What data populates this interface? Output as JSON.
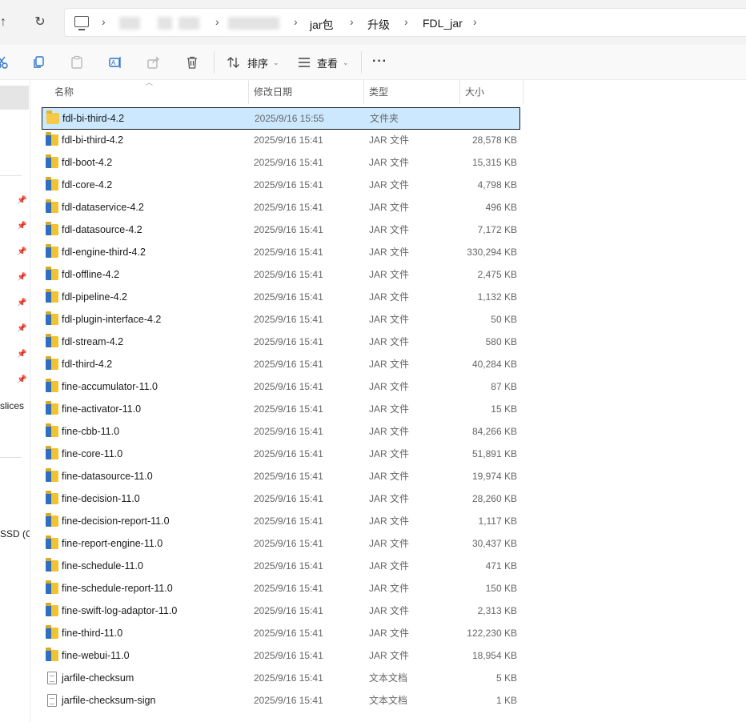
{
  "address": {
    "crumbs": [
      "jar包",
      "升级",
      "FDL_jar"
    ]
  },
  "toolbar": {
    "sort_label": "排序",
    "view_label": "查看",
    "more_label": "···"
  },
  "nav": {
    "items": [
      "slices",
      "SSD (C"
    ]
  },
  "columns": {
    "name": "名称",
    "date": "修改日期",
    "type": "类型",
    "size": "大小"
  },
  "files": [
    {
      "name": "fdl-bi-third-4.2",
      "date": "2025/9/16 15:55",
      "type": "文件夹",
      "size": "",
      "icon": "folder-icon",
      "selected": true
    },
    {
      "name": "fdl-bi-third-4.2",
      "date": "2025/9/16 15:41",
      "type": "JAR 文件",
      "size": "28,578 KB",
      "icon": "jar-file-icon"
    },
    {
      "name": "fdl-boot-4.2",
      "date": "2025/9/16 15:41",
      "type": "JAR 文件",
      "size": "15,315 KB",
      "icon": "jar-file-icon"
    },
    {
      "name": "fdl-core-4.2",
      "date": "2025/9/16 15:41",
      "type": "JAR 文件",
      "size": "4,798 KB",
      "icon": "jar-file-icon"
    },
    {
      "name": "fdl-dataservice-4.2",
      "date": "2025/9/16 15:41",
      "type": "JAR 文件",
      "size": "496 KB",
      "icon": "jar-file-icon"
    },
    {
      "name": "fdl-datasource-4.2",
      "date": "2025/9/16 15:41",
      "type": "JAR 文件",
      "size": "7,172 KB",
      "icon": "jar-file-icon"
    },
    {
      "name": "fdl-engine-third-4.2",
      "date": "2025/9/16 15:41",
      "type": "JAR 文件",
      "size": "330,294 KB",
      "icon": "jar-file-icon"
    },
    {
      "name": "fdl-offline-4.2",
      "date": "2025/9/16 15:41",
      "type": "JAR 文件",
      "size": "2,475 KB",
      "icon": "jar-file-icon"
    },
    {
      "name": "fdl-pipeline-4.2",
      "date": "2025/9/16 15:41",
      "type": "JAR 文件",
      "size": "1,132 KB",
      "icon": "jar-file-icon"
    },
    {
      "name": "fdl-plugin-interface-4.2",
      "date": "2025/9/16 15:41",
      "type": "JAR 文件",
      "size": "50 KB",
      "icon": "jar-file-icon"
    },
    {
      "name": "fdl-stream-4.2",
      "date": "2025/9/16 15:41",
      "type": "JAR 文件",
      "size": "580 KB",
      "icon": "jar-file-icon"
    },
    {
      "name": "fdl-third-4.2",
      "date": "2025/9/16 15:41",
      "type": "JAR 文件",
      "size": "40,284 KB",
      "icon": "jar-file-icon"
    },
    {
      "name": "fine-accumulator-11.0",
      "date": "2025/9/16 15:41",
      "type": "JAR 文件",
      "size": "87 KB",
      "icon": "jar-file-icon"
    },
    {
      "name": "fine-activator-11.0",
      "date": "2025/9/16 15:41",
      "type": "JAR 文件",
      "size": "15 KB",
      "icon": "jar-file-icon"
    },
    {
      "name": "fine-cbb-11.0",
      "date": "2025/9/16 15:41",
      "type": "JAR 文件",
      "size": "84,266 KB",
      "icon": "jar-file-icon"
    },
    {
      "name": "fine-core-11.0",
      "date": "2025/9/16 15:41",
      "type": "JAR 文件",
      "size": "51,891 KB",
      "icon": "jar-file-icon"
    },
    {
      "name": "fine-datasource-11.0",
      "date": "2025/9/16 15:41",
      "type": "JAR 文件",
      "size": "19,974 KB",
      "icon": "jar-file-icon"
    },
    {
      "name": "fine-decision-11.0",
      "date": "2025/9/16 15:41",
      "type": "JAR 文件",
      "size": "28,260 KB",
      "icon": "jar-file-icon"
    },
    {
      "name": "fine-decision-report-11.0",
      "date": "2025/9/16 15:41",
      "type": "JAR 文件",
      "size": "1,117 KB",
      "icon": "jar-file-icon"
    },
    {
      "name": "fine-report-engine-11.0",
      "date": "2025/9/16 15:41",
      "type": "JAR 文件",
      "size": "30,437 KB",
      "icon": "jar-file-icon"
    },
    {
      "name": "fine-schedule-11.0",
      "date": "2025/9/16 15:41",
      "type": "JAR 文件",
      "size": "471 KB",
      "icon": "jar-file-icon"
    },
    {
      "name": "fine-schedule-report-11.0",
      "date": "2025/9/16 15:41",
      "type": "JAR 文件",
      "size": "150 KB",
      "icon": "jar-file-icon"
    },
    {
      "name": "fine-swift-log-adaptor-11.0",
      "date": "2025/9/16 15:41",
      "type": "JAR 文件",
      "size": "2,313 KB",
      "icon": "jar-file-icon"
    },
    {
      "name": "fine-third-11.0",
      "date": "2025/9/16 15:41",
      "type": "JAR 文件",
      "size": "122,230 KB",
      "icon": "jar-file-icon"
    },
    {
      "name": "fine-webui-11.0",
      "date": "2025/9/16 15:41",
      "type": "JAR 文件",
      "size": "18,954 KB",
      "icon": "jar-file-icon"
    },
    {
      "name": "jarfile-checksum",
      "date": "2025/9/16 15:41",
      "type": "文本文档",
      "size": "5 KB",
      "icon": "text-file-icon"
    },
    {
      "name": "jarfile-checksum-sign",
      "date": "2025/9/16 15:41",
      "type": "文本文档",
      "size": "1 KB",
      "icon": "text-file-icon"
    }
  ]
}
